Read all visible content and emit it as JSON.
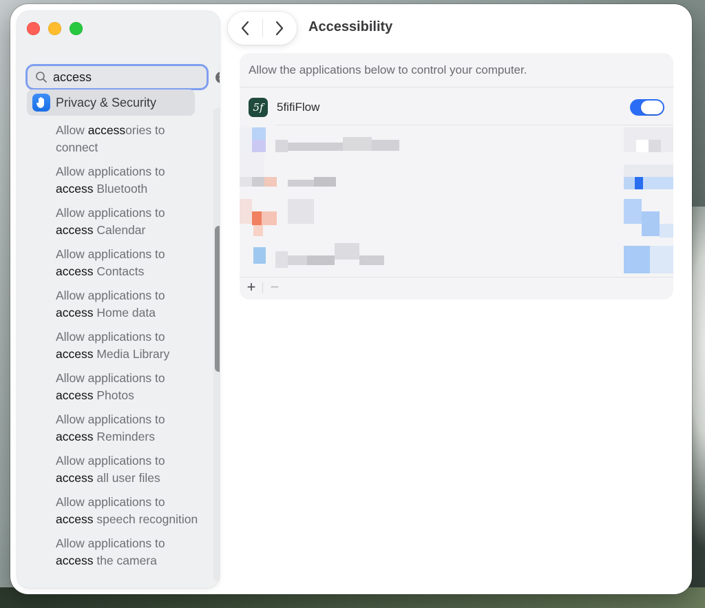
{
  "window": {
    "page_title": "Accessibility"
  },
  "sidebar": {
    "search": {
      "value": "access",
      "placeholder": "Search"
    },
    "category": {
      "label": "Privacy & Security",
      "icon": "hand-raised-icon"
    },
    "results": [
      {
        "prefix": "Allow ",
        "match": "access",
        "suffix": "ories to connect"
      },
      {
        "prefix": "Allow applications to ",
        "match": "access",
        "suffix": " Bluetooth"
      },
      {
        "prefix": "Allow applications to ",
        "match": "access",
        "suffix": " Calendar"
      },
      {
        "prefix": "Allow applications to ",
        "match": "access",
        "suffix": " Contacts"
      },
      {
        "prefix": "Allow applications to ",
        "match": "access",
        "suffix": " Home data"
      },
      {
        "prefix": "Allow applications to ",
        "match": "access",
        "suffix": " Media Library"
      },
      {
        "prefix": "Allow applications to ",
        "match": "access",
        "suffix": " Photos"
      },
      {
        "prefix": "Allow applications to ",
        "match": "access",
        "suffix": " Reminders"
      },
      {
        "prefix": "Allow applications to ",
        "match": "access",
        "suffix": " all user files"
      },
      {
        "prefix": "Allow applications to ",
        "match": "access",
        "suffix": " speech recognition"
      },
      {
        "prefix": "Allow applications to ",
        "match": "access",
        "suffix": " the camera"
      }
    ]
  },
  "main": {
    "description": "Allow the applications below to control your computer.",
    "apps": [
      {
        "name": "5fifiFlow",
        "icon_glyph": "5f",
        "enabled": true
      }
    ],
    "footer": {
      "add_label": "+",
      "remove_label": "−"
    }
  },
  "colors": {
    "accent": "#2b6ef5",
    "search_focus_ring": "#7f9ef0",
    "traffic_close": "#fe5f57",
    "traffic_minimize": "#febc2e",
    "traffic_zoom": "#28c840",
    "app_icon_bg": "#1f4a3c"
  }
}
